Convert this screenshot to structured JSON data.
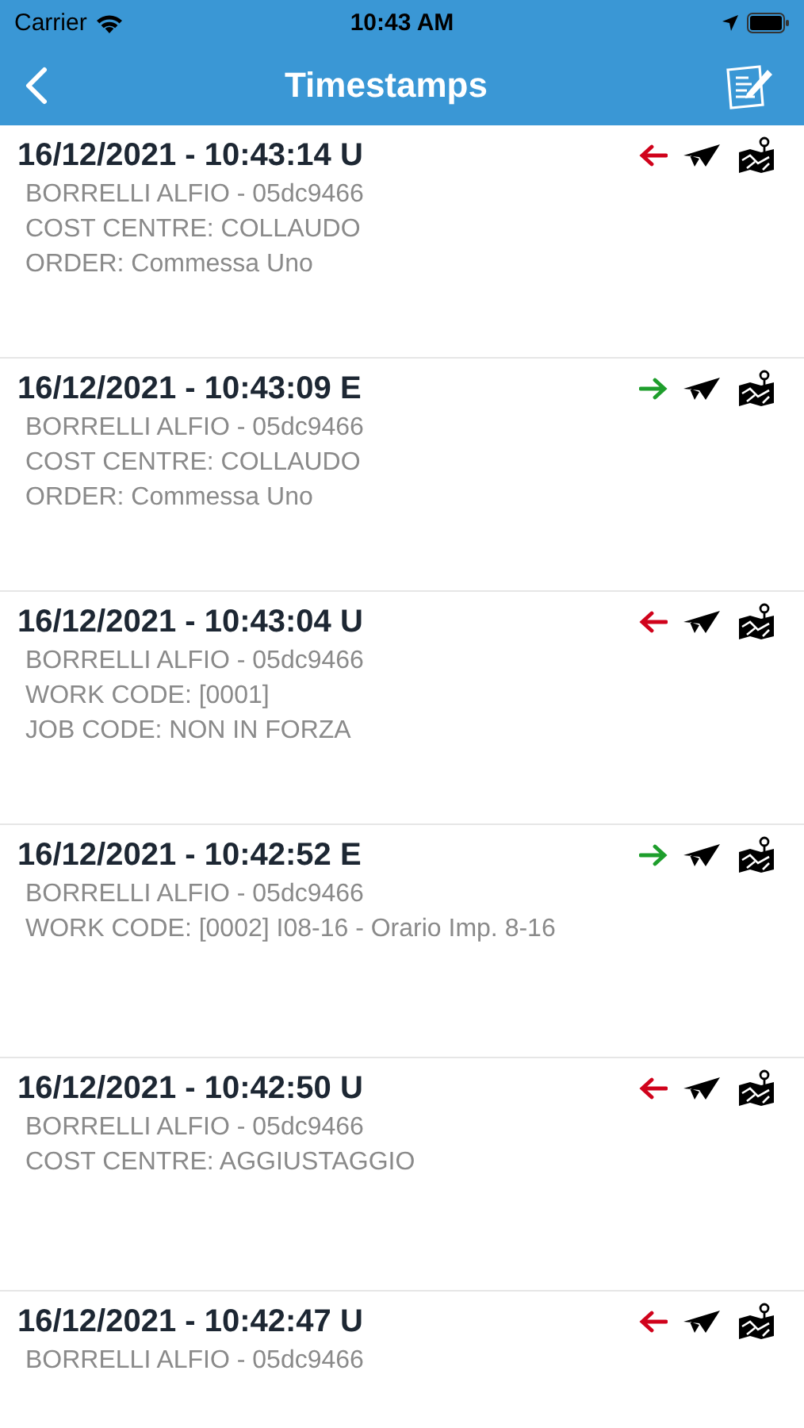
{
  "status_bar": {
    "carrier": "Carrier",
    "time": "10:43 AM"
  },
  "nav": {
    "title": "Timestamps"
  },
  "entries": [
    {
      "heading": "16/12/2021 - 10:43:14 U",
      "kind": "out",
      "lines": [
        "BORRELLI ALFIO - 05dc9466",
        "COST CENTRE: COLLAUDO",
        "ORDER: Commessa Uno"
      ]
    },
    {
      "heading": "16/12/2021 - 10:43:09 E",
      "kind": "in",
      "lines": [
        "BORRELLI ALFIO - 05dc9466",
        "COST CENTRE: COLLAUDO",
        "ORDER: Commessa Uno"
      ]
    },
    {
      "heading": "16/12/2021 - 10:43:04 U",
      "kind": "out",
      "lines": [
        "BORRELLI ALFIO - 05dc9466",
        "WORK CODE: [0001]",
        "JOB CODE: NON IN FORZA"
      ]
    },
    {
      "heading": "16/12/2021 - 10:42:52 E",
      "kind": "in",
      "lines": [
        "BORRELLI ALFIO - 05dc9466",
        "WORK CODE: [0002] I08-16 - Orario Imp. 8-16"
      ]
    },
    {
      "heading": "16/12/2021 - 10:42:50 U",
      "kind": "out",
      "lines": [
        "BORRELLI ALFIO - 05dc9466",
        "COST CENTRE: AGGIUSTAGGIO"
      ]
    },
    {
      "heading": "16/12/2021 - 10:42:47 U",
      "kind": "out",
      "lines": [
        "BORRELLI ALFIO - 05dc9466"
      ]
    }
  ]
}
